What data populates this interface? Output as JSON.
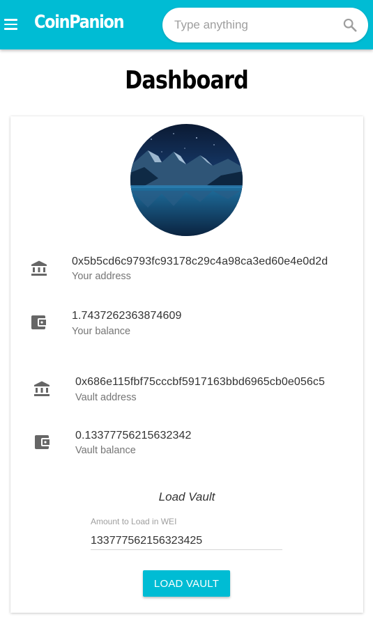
{
  "header": {
    "brand": "CoinPanion",
    "search_placeholder": "Type anything",
    "menu_icon": "hamburger-menu-icon",
    "search_icon": "search-icon",
    "accent_color": "#00bcd4"
  },
  "page": {
    "title": "Dashboard"
  },
  "profile": {
    "avatar": "mountain-lake-night-photo"
  },
  "account": {
    "address": "0x5b5cd6c9793fc93178c29c4a98ca3ed60e4e0d2d",
    "address_label": "Your address",
    "balance": "1.7437262363874609",
    "balance_label": "Your balance"
  },
  "vault": {
    "address": "0x686e115fbf75cccbf5917163bbd6965cb0e056c5",
    "address_label": "Vault address",
    "balance": "0.13377756215632342",
    "balance_label": "Vault balance"
  },
  "load_vault": {
    "heading": "Load Vault",
    "amount_label": "Amount to Load in WEI",
    "amount_value": "133777562156323425",
    "button_label": "LOAD VAULT"
  }
}
